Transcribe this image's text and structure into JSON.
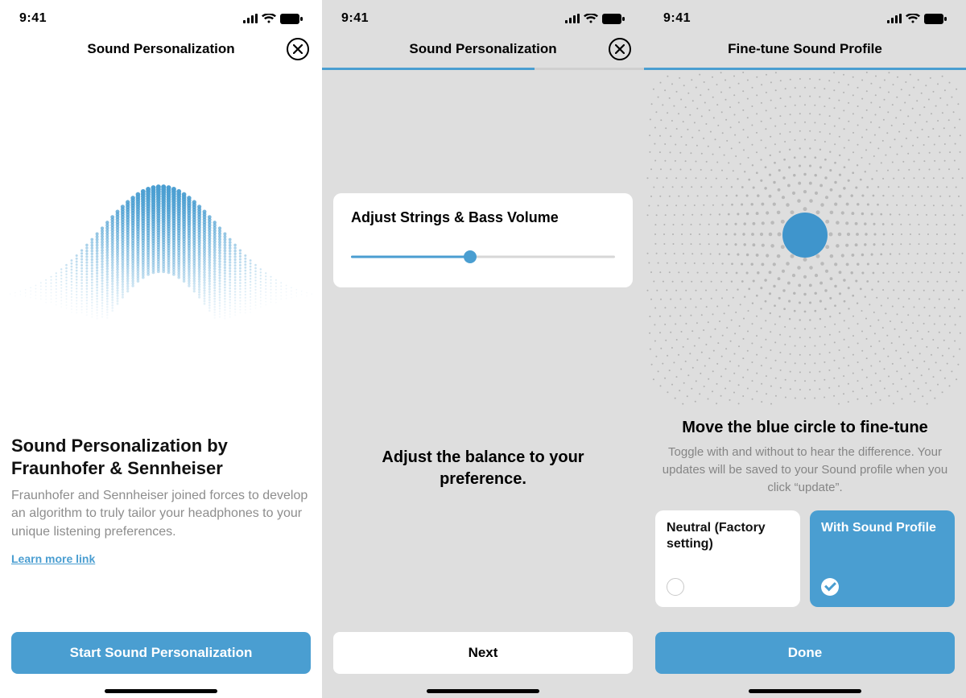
{
  "status": {
    "time": "9:41"
  },
  "colors": {
    "accent": "#4a9ed1"
  },
  "screen1": {
    "title": "Sound Personalization",
    "heading": "Sound Personalization by Fraunhofer & Sennheiser",
    "paragraph": "Fraunhofer and Sennheiser joined forces to develop an algorithm to truly tailor your headphones to your unique listening preferences.",
    "learn_more": "Learn more link",
    "start_button": "Start Sound Personalization"
  },
  "screen2": {
    "title": "Sound Personalization",
    "card_title": "Adjust Strings & Bass Volume",
    "slider_value": 0.45,
    "instruction": "Adjust the balance to your preference.",
    "next_button": "Next"
  },
  "screen3": {
    "title": "Fine-tune Sound Profile",
    "heading": "Move the blue circle to fine-tune",
    "subtext": "Toggle with and without to hear the difference. Your updates will be saved to your Sound profile when you click “update”.",
    "option_a": "Neutral (Factory setting)",
    "option_b": "With Sound Profile",
    "selected": "b",
    "done_button": "Done"
  }
}
